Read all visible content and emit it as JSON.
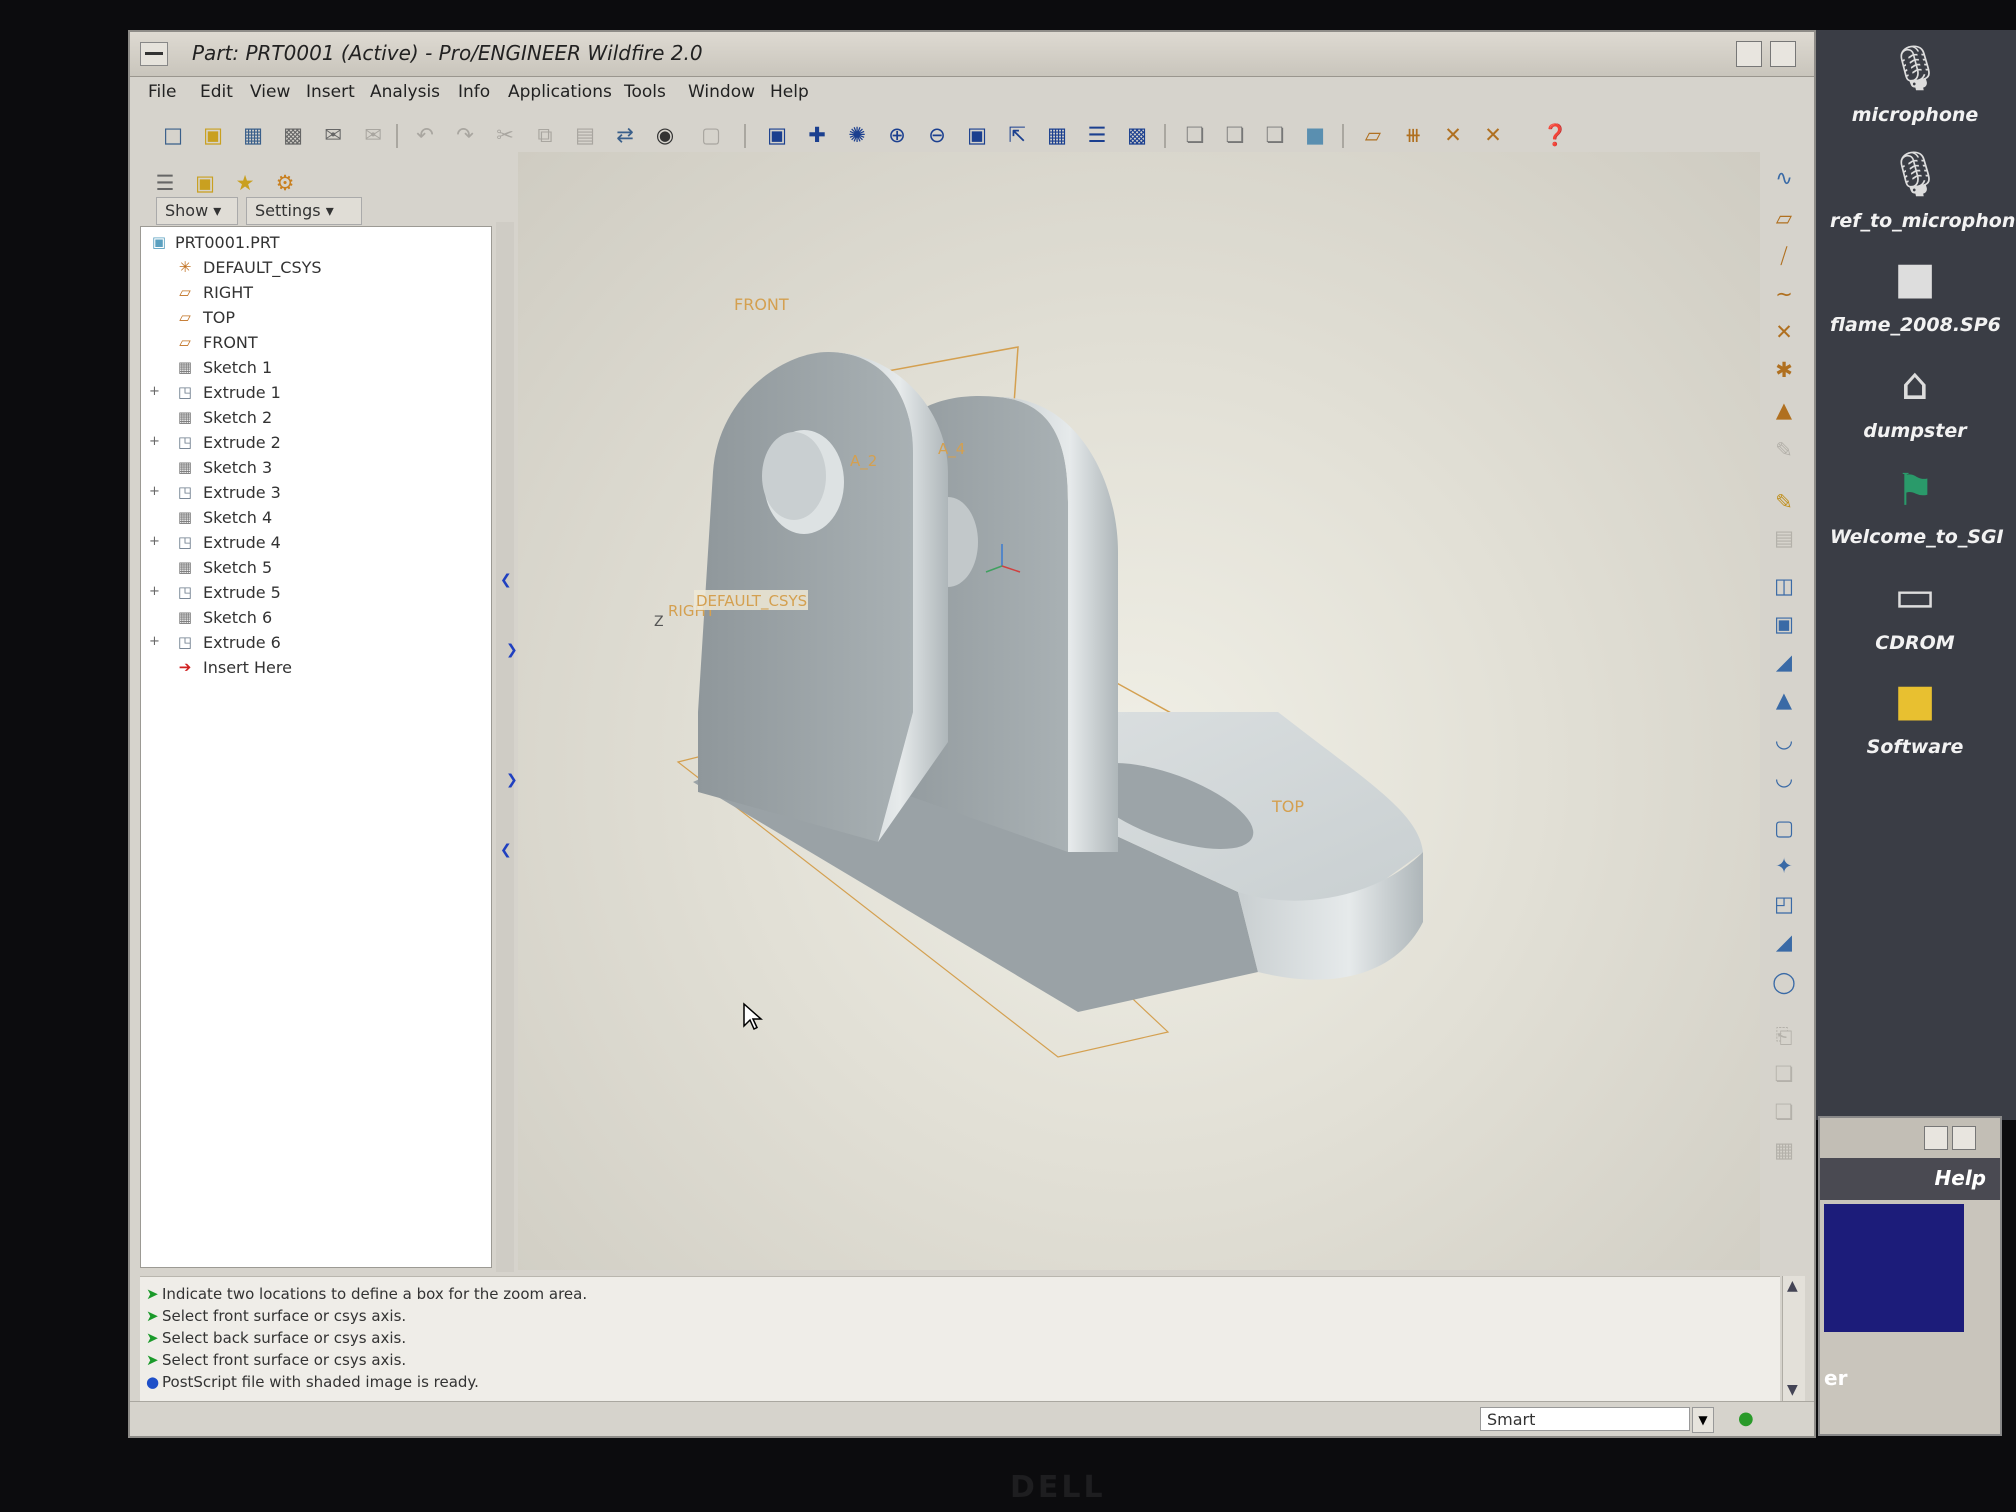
{
  "window": {
    "title": "Part: PRT0001 (Active) - Pro/ENGINEER Wildfire 2.0"
  },
  "menu": [
    "File",
    "Edit",
    "View",
    "Insert",
    "Analysis",
    "Info",
    "Applications",
    "Tools",
    "Window",
    "Help"
  ],
  "navigator": {
    "show_label": "Show",
    "settings_label": "Settings"
  },
  "model_tree": {
    "root": "PRT0001.PRT",
    "items": [
      {
        "label": "DEFAULT_CSYS",
        "icon": "csys-icon",
        "expandable": false
      },
      {
        "label": "RIGHT",
        "icon": "datum-plane-icon",
        "expandable": false
      },
      {
        "label": "TOP",
        "icon": "datum-plane-icon",
        "expandable": false
      },
      {
        "label": "FRONT",
        "icon": "datum-plane-icon",
        "expandable": false
      },
      {
        "label": "Sketch 1",
        "icon": "sketch-icon",
        "expandable": false
      },
      {
        "label": "Extrude 1",
        "icon": "extrude-icon",
        "expandable": true
      },
      {
        "label": "Sketch 2",
        "icon": "sketch-icon",
        "expandable": false
      },
      {
        "label": "Extrude 2",
        "icon": "extrude-icon",
        "expandable": true
      },
      {
        "label": "Sketch 3",
        "icon": "sketch-icon",
        "expandable": false
      },
      {
        "label": "Extrude 3",
        "icon": "extrude-icon",
        "expandable": true
      },
      {
        "label": "Sketch 4",
        "icon": "sketch-icon",
        "expandable": false
      },
      {
        "label": "Extrude 4",
        "icon": "extrude-icon",
        "expandable": true
      },
      {
        "label": "Sketch 5",
        "icon": "sketch-icon",
        "expandable": false
      },
      {
        "label": "Extrude 5",
        "icon": "extrude-icon",
        "expandable": true
      },
      {
        "label": "Sketch 6",
        "icon": "sketch-icon",
        "expandable": false
      },
      {
        "label": "Extrude 6",
        "icon": "extrude-icon",
        "expandable": true
      },
      {
        "label": "Insert Here",
        "icon": "insert-arrow-icon",
        "expandable": false
      }
    ]
  },
  "graphics": {
    "datum_front": "FRONT",
    "datum_top": "TOP",
    "datum_right": "RIGHT",
    "csys_label": "DEFAULT_CSYS",
    "axis_a2": "A_2",
    "axis_a4": "A_4",
    "axis_z": "Z"
  },
  "messages": [
    {
      "type": "prompt",
      "text": "Indicate two locations to define a box for the zoom area."
    },
    {
      "type": "prompt",
      "text": "Select front surface or csys axis."
    },
    {
      "type": "prompt",
      "text": "Select back surface or csys axis."
    },
    {
      "type": "prompt",
      "text": "Select front surface or csys axis."
    },
    {
      "type": "info",
      "text": "PostScript file with shaded image is ready."
    }
  ],
  "status": {
    "filter_value": "Smart"
  },
  "desktop_icons": [
    {
      "label": "microphone",
      "icon": "microphone-icon"
    },
    {
      "label": "ref_to_microphone",
      "icon": "microphone-icon"
    },
    {
      "label": "flame_2008.SP6",
      "icon": "folder-icon"
    },
    {
      "label": "dumpster",
      "icon": "dumpster-icon"
    },
    {
      "label": "Welcome_to_SGI",
      "icon": "welcome-icon"
    },
    {
      "label": "CDROM",
      "icon": "cdrom-icon"
    },
    {
      "label": "Software",
      "icon": "folder-icon"
    }
  ],
  "second_window": {
    "help_label": "Help",
    "partial_text": "er"
  },
  "monitor_brand": "DELL",
  "colors": {
    "datum_orange": "#d4a050",
    "model_gray": "#b9bfc2",
    "prompt_green": "#1a9a2a",
    "info_blue": "#1e4fc8"
  }
}
